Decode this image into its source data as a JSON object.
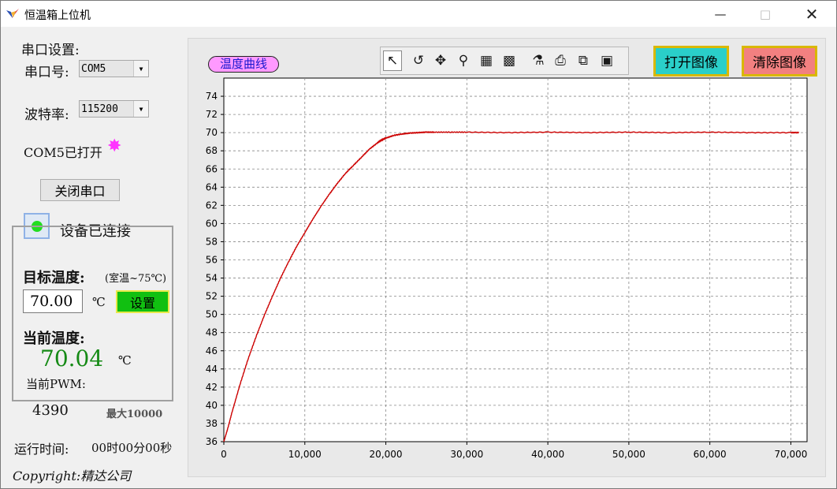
{
  "window": {
    "title": "恒温箱上位机"
  },
  "serial": {
    "section_label": "串口设置:",
    "port_label": "串口号:",
    "port_value": "COM5",
    "baud_label": "波特率:",
    "baud_value": "115200",
    "status_text": "COM5已打开",
    "close_button": "关闭串口",
    "device_status": "设备已连接",
    "status_color": "#ff33ff",
    "device_led_color": "#22dd22"
  },
  "control": {
    "target_label": "目标温度:",
    "target_range": "(室温~75℃)",
    "target_value": "70.00",
    "unit": "℃",
    "set_button": "设置",
    "current_label": "当前温度:",
    "current_value": "70.04",
    "current_unit": "℃",
    "pwm_label": "当前PWM:",
    "pwm_value": "4390",
    "pwm_max": "最大10000"
  },
  "footer": {
    "runtime_label": "运行时间:",
    "runtime_value": "00时00分00秒",
    "copyright": "Copyright:精达公司"
  },
  "chart_panel": {
    "curve_label": "温度曲线",
    "open_button": "打开图像",
    "clear_button": "清除图像",
    "toolbar_icons": [
      "pointer-icon",
      "undo-icon",
      "pan-icon",
      "zoom-icon",
      "axis-scale-icon",
      "edit-plot-icon",
      "properties-icon",
      "print-icon",
      "copy-icon",
      "save-icon"
    ]
  },
  "chart_data": {
    "type": "line",
    "xlim": [
      0,
      72000
    ],
    "ylim": [
      36,
      76
    ],
    "x_ticks": [
      0,
      10000,
      20000,
      30000,
      40000,
      50000,
      60000,
      70000
    ],
    "x_tick_labels": [
      "0",
      "10,000",
      "20,000",
      "30,000",
      "40,000",
      "50,000",
      "60,000",
      "70,000"
    ],
    "y_ticks": [
      36,
      38,
      40,
      42,
      44,
      46,
      48,
      50,
      52,
      54,
      56,
      58,
      60,
      62,
      64,
      66,
      68,
      70,
      72,
      74
    ],
    "grid": true,
    "series": [
      {
        "color": "#cc0000",
        "x": [
          0,
          500,
          1000,
          2000,
          3000,
          4000,
          5000,
          6000,
          7000,
          8000,
          9000,
          10000,
          11000,
          12000,
          13000,
          14000,
          15000,
          16000,
          17000,
          18000,
          19000,
          19500,
          20000,
          21000,
          22000,
          23000,
          24000,
          25000,
          26000,
          28000,
          30000,
          35000,
          40000,
          45000,
          50000,
          55000,
          60000,
          65000,
          70000,
          71000
        ],
        "y": [
          36.0,
          37.5,
          39.2,
          42.3,
          45.1,
          47.6,
          49.9,
          52.0,
          54.0,
          55.8,
          57.5,
          59.0,
          60.5,
          61.9,
          63.2,
          64.4,
          65.5,
          66.4,
          67.3,
          68.2,
          68.9,
          69.2,
          69.4,
          69.7,
          69.85,
          69.95,
          70.0,
          70.05,
          70.05,
          70.05,
          70.05,
          70.0,
          70.05,
          70.0,
          70.05,
          70.0,
          70.05,
          70.0,
          70.0,
          70.0
        ]
      }
    ]
  }
}
